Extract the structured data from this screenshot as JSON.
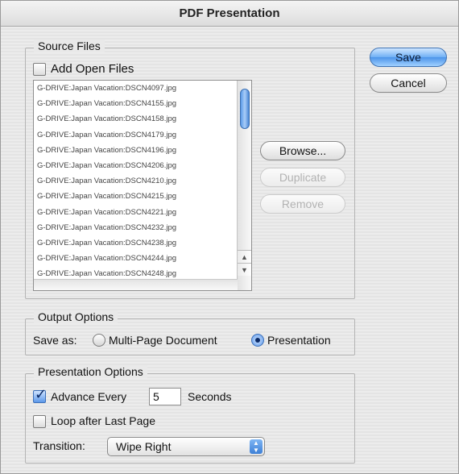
{
  "window": {
    "title": "PDF Presentation"
  },
  "source_files": {
    "group_title": "Source Files",
    "add_open_files_label": "Add Open Files",
    "add_open_files_checked": false,
    "files": [
      "G-DRIVE:Japan Vacation:DSCN4097.jpg",
      "G-DRIVE:Japan Vacation:DSCN4155.jpg",
      "G-DRIVE:Japan Vacation:DSCN4158.jpg",
      "G-DRIVE:Japan Vacation:DSCN4179.jpg",
      "G-DRIVE:Japan Vacation:DSCN4196.jpg",
      "G-DRIVE:Japan Vacation:DSCN4206.jpg",
      "G-DRIVE:Japan Vacation:DSCN4210.jpg",
      "G-DRIVE:Japan Vacation:DSCN4215.jpg",
      "G-DRIVE:Japan Vacation:DSCN4221.jpg",
      "G-DRIVE:Japan Vacation:DSCN4232.jpg",
      "G-DRIVE:Japan Vacation:DSCN4238.jpg",
      "G-DRIVE:Japan Vacation:DSCN4244.jpg",
      "G-DRIVE:Japan Vacation:DSCN4248.jpg"
    ],
    "browse_label": "Browse...",
    "duplicate_label": "Duplicate",
    "remove_label": "Remove"
  },
  "dialog_buttons": {
    "save_label": "Save",
    "cancel_label": "Cancel"
  },
  "output_options": {
    "group_title": "Output Options",
    "save_as_label": "Save as:",
    "options": [
      "Multi-Page Document",
      "Presentation"
    ],
    "selected": "Presentation"
  },
  "presentation_options": {
    "group_title": "Presentation Options",
    "advance_every_label": "Advance Every",
    "advance_every_checked": true,
    "advance_every_value": "5",
    "seconds_label": "Seconds",
    "loop_label": "Loop after Last Page",
    "loop_checked": false,
    "transition_label": "Transition:",
    "transition_value": "Wipe Right"
  },
  "icons": {
    "checkmark": "checkmark-icon",
    "scroll_up": "arrow-up-icon",
    "scroll_down": "arrow-down-icon",
    "popup_arrows": "updown-arrows-icon"
  },
  "colors": {
    "accent": "#5d99ea",
    "primary_button": "#4d94ea"
  }
}
